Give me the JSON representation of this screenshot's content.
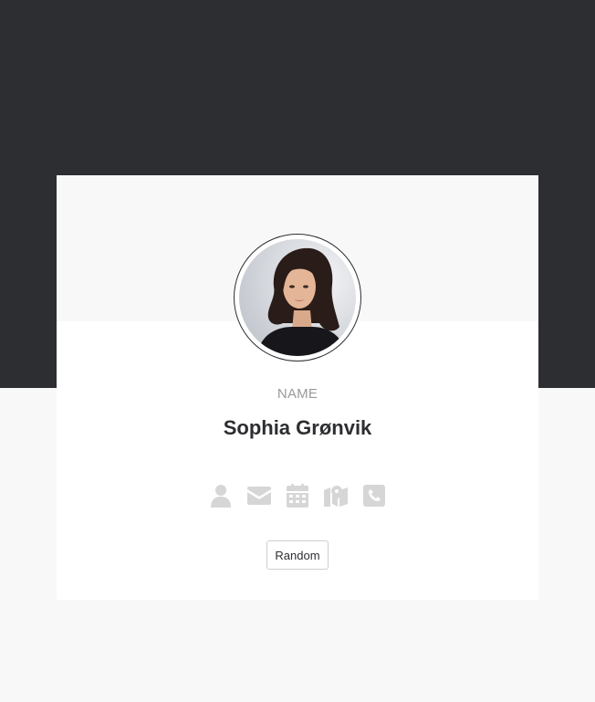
{
  "profile": {
    "label": "NAME",
    "value": "Sophia Grønvik"
  },
  "icons": [
    "person-icon",
    "envelope-icon",
    "calendar-icon",
    "map-icon",
    "phone-icon"
  ],
  "actions": {
    "random_label": "Random"
  },
  "colors": {
    "dark_band": "#2d2e32",
    "page_bg": "#f8f8f8",
    "card_bg": "#ffffff",
    "icon": "#d6d6d6",
    "label": "#9a9a9a"
  }
}
